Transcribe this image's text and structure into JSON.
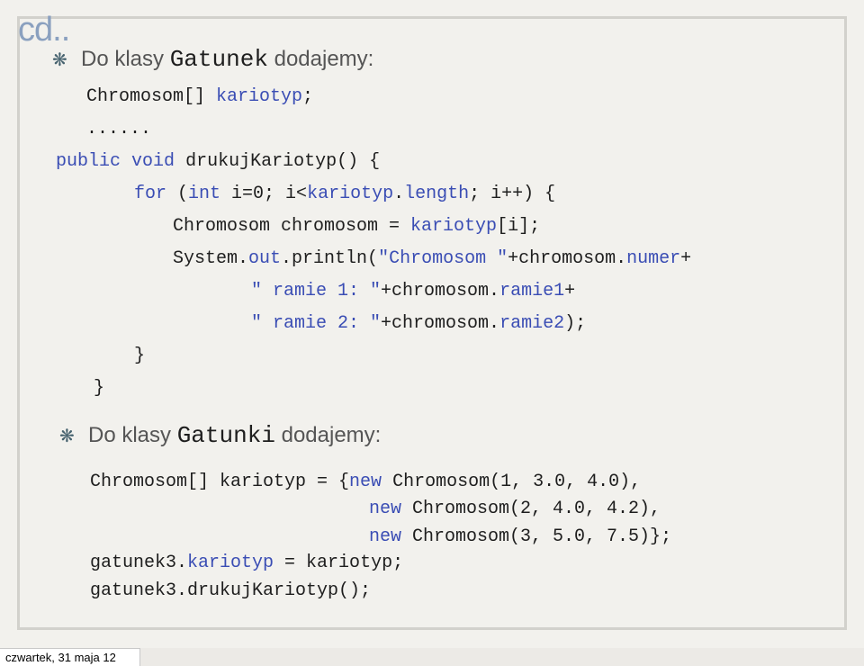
{
  "slide": {
    "title": "cd..",
    "bullet1": {
      "icon": "snowflake-bullet-icon",
      "prefix": "Do klasy ",
      "class_name": "Gatunek",
      "suffix": " dodajemy:"
    },
    "code1": {
      "l1_type": "Chromosom[] ",
      "l1_name": "kariotyp",
      "l1_end": ";",
      "l2": "......",
      "l3_public": "public",
      "l3_void": "void",
      "l3_rest": "drukujKariotyp() {",
      "l4_for": "for",
      "l4_a": " (",
      "l4_int": "int",
      "l4_b": " i=0; i<",
      "l4_kariotyp": "kariotyp",
      "l4_c": ".",
      "l4_length": "length",
      "l4_d": "; i++) {",
      "l5_a": "Chromosom chromosom = ",
      "l5_kariotyp": "kariotyp",
      "l5_b": "[i];",
      "l6_a": "System.",
      "l6_out": "out",
      "l6_b": ".println(",
      "l6_str": "\"Chromosom \"",
      "l6_c": "+chromosom.",
      "l6_numer": "numer",
      "l6_d": "+",
      "l7_str": "\" ramie 1: \"",
      "l7_a": "+chromosom.",
      "l7_field": "ramie1",
      "l7_b": "+",
      "l8_str": "\" ramie 2: \"",
      "l8_a": "+chromosom.",
      "l8_field": "ramie2",
      "l8_b": ");",
      "l9": "}",
      "l10": "}"
    },
    "bullet2": {
      "icon": "snowflake-bullet-icon",
      "prefix": "Do klasy ",
      "class_name": "Gatunki",
      "suffix": " dodajemy:"
    },
    "code2": {
      "l1_a": "Chromosom[] kariotyp = {",
      "l1_new": "new",
      "l1_b": " Chromosom(1, 3.0, 4.0),",
      "l2_new": "new",
      "l2_b": " Chromosom(2, 4.0, 4.2),",
      "l3_new": "new",
      "l3_b": " Chromosom(3, 5.0, 7.5)};",
      "l4_a": "gatunek3.",
      "l4_kariotyp": "kariotyp",
      "l4_b": " = kariotyp;",
      "l5": "gatunek3.drukujKariotyp();"
    }
  },
  "footer": {
    "date": "czwartek, 31 maja 12"
  },
  "colors": {
    "keyword": "#3a4db4",
    "title": "#8aa0bf",
    "text": "#1e1e1e",
    "bullet_text": "#555555",
    "background": "#f2f1ed"
  }
}
